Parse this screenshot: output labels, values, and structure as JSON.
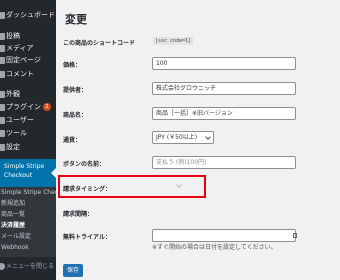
{
  "sidebar": {
    "items": [
      {
        "label": "ダッシュボード",
        "name": "sidebar-item-dashboard"
      },
      {
        "label": "投稿",
        "name": "sidebar-item-posts"
      },
      {
        "label": "メディア",
        "name": "sidebar-item-media"
      },
      {
        "label": "固定ページ",
        "name": "sidebar-item-pages"
      },
      {
        "label": "コメント",
        "name": "sidebar-item-comments"
      },
      {
        "label": "外観",
        "name": "sidebar-item-appearance"
      },
      {
        "label": "プラグイン",
        "name": "sidebar-item-plugins",
        "badge": "2"
      },
      {
        "label": "ユーザー",
        "name": "sidebar-item-users"
      },
      {
        "label": "ツール",
        "name": "sidebar-item-tools"
      },
      {
        "label": "設定",
        "name": "sidebar-item-settings"
      }
    ],
    "active_label": "Simple Stripe Checkout",
    "submenu": [
      "Simple Stripe Checkout",
      "新規追加",
      "商品一覧",
      "決済履歴",
      "メール設定",
      "Webhook"
    ],
    "collapse_label": "メニューを閉じる"
  },
  "main": {
    "title": "変更",
    "shortcode_label": "この商品のショートコード",
    "shortcode_value": "[ssc code=1]",
    "price_label": "価格：",
    "price_value": "100",
    "provider_label": "提供者：",
    "provider_value": "株式会社グロウニッチ",
    "product_label": "商品名：",
    "product_value": "商品［一括］※旧バージョン",
    "currency_label": "通貨：",
    "currency_value": "JPY (￥50以上)",
    "button_label": "ボタンの名前：",
    "button_placeholder": "支払う (例)100円)",
    "billing_timing_label": "請求タイミング：",
    "billing_interval_label": "請求間隔：",
    "trial_label": "無料トライアル：",
    "trial_note": "※すぐ開始の場合は日付を設定してください。",
    "save_label": "保存"
  },
  "colors": {
    "sidebar_bg": "#23282d",
    "sidebar_active": "#0073aa",
    "highlight_border": "#e60012",
    "primary_button": "#2271b1"
  }
}
